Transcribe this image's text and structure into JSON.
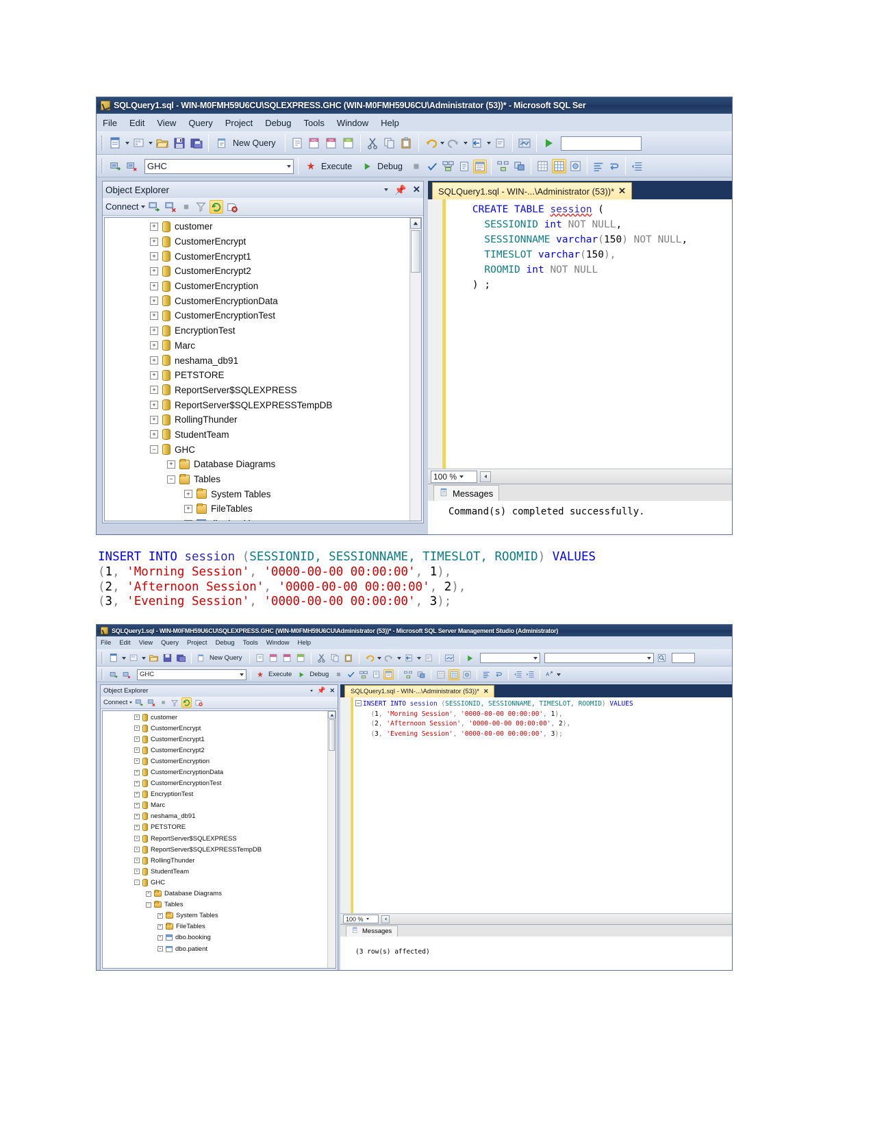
{
  "window_top": {
    "title": "SQLQuery1.sql - WIN-M0FMH59U6CU\\SQLEXPRESS.GHC (WIN-M0FMH59U6CU\\Administrator (53))* - Microsoft SQL Ser",
    "menu": [
      "File",
      "Edit",
      "View",
      "Query",
      "Project",
      "Debug",
      "Tools",
      "Window",
      "Help"
    ],
    "toolbar": {
      "new_query_label": "New Query",
      "database_combo": "GHC",
      "execute_label": "Execute",
      "debug_label": "Debug",
      "find_combo": ""
    },
    "object_explorer": {
      "title": "Object Explorer",
      "connect_label": "Connect",
      "nodes": [
        {
          "label": "customer",
          "icon": "database-icon",
          "state": "collapsed",
          "indent": 1
        },
        {
          "label": "CustomerEncrypt",
          "icon": "database-icon",
          "state": "collapsed",
          "indent": 1
        },
        {
          "label": "CustomerEncrypt1",
          "icon": "database-icon",
          "state": "collapsed",
          "indent": 1
        },
        {
          "label": "CustomerEncrypt2",
          "icon": "database-icon",
          "state": "collapsed",
          "indent": 1
        },
        {
          "label": "CustomerEncryption",
          "icon": "database-icon",
          "state": "collapsed",
          "indent": 1
        },
        {
          "label": "CustomerEncryptionData",
          "icon": "database-icon",
          "state": "collapsed",
          "indent": 1
        },
        {
          "label": "CustomerEncryptionTest",
          "icon": "database-icon",
          "state": "collapsed",
          "indent": 1
        },
        {
          "label": "EncryptionTest",
          "icon": "database-icon",
          "state": "collapsed",
          "indent": 1
        },
        {
          "label": "Marc",
          "icon": "database-icon",
          "state": "collapsed",
          "indent": 1
        },
        {
          "label": "neshama_db91",
          "icon": "database-icon",
          "state": "collapsed",
          "indent": 1
        },
        {
          "label": "PETSTORE",
          "icon": "database-icon",
          "state": "collapsed",
          "indent": 1
        },
        {
          "label": "ReportServer$SQLEXPRESS",
          "icon": "database-icon",
          "state": "collapsed",
          "indent": 1
        },
        {
          "label": "ReportServer$SQLEXPRESSTempDB",
          "icon": "database-icon",
          "state": "collapsed",
          "indent": 1
        },
        {
          "label": "RollingThunder",
          "icon": "database-icon",
          "state": "collapsed",
          "indent": 1
        },
        {
          "label": "StudentTeam",
          "icon": "database-icon",
          "state": "collapsed",
          "indent": 1
        },
        {
          "label": "GHC",
          "icon": "database-icon",
          "state": "expanded",
          "indent": 1
        },
        {
          "label": "Database Diagrams",
          "icon": "folder-icon",
          "state": "collapsed",
          "indent": 2
        },
        {
          "label": "Tables",
          "icon": "folder-icon",
          "state": "expanded",
          "indent": 2
        },
        {
          "label": "System Tables",
          "icon": "folder-icon",
          "state": "collapsed",
          "indent": 3
        },
        {
          "label": "FileTables",
          "icon": "folder-icon",
          "state": "collapsed",
          "indent": 3
        },
        {
          "label": "dbo.booking",
          "icon": "table-icon",
          "state": "collapsed",
          "indent": 3
        }
      ]
    },
    "document_tab": "SQLQuery1.sql - WIN-...\\Administrator (53))*",
    "code_lines": [
      [
        {
          "t": "    ",
          "c": "plain"
        },
        {
          "t": "CREATE",
          "c": "kw"
        },
        {
          "t": " ",
          "c": "plain"
        },
        {
          "t": "TABLE",
          "c": "kw"
        },
        {
          "t": " ",
          "c": "plain"
        },
        {
          "t": "session",
          "c": "ident-tbl sq"
        },
        {
          "t": " (",
          "c": "plain"
        }
      ],
      [
        {
          "t": "      ",
          "c": "plain"
        },
        {
          "t": "SESSIONID",
          "c": "idn"
        },
        {
          "t": " ",
          "c": "plain"
        },
        {
          "t": "int",
          "c": "typ"
        },
        {
          "t": " ",
          "c": "plain"
        },
        {
          "t": "NOT NULL",
          "c": "gry"
        },
        {
          "t": ",",
          "c": "plain"
        }
      ],
      [
        {
          "t": "      ",
          "c": "plain"
        },
        {
          "t": "SESSIONNAME",
          "c": "idn"
        },
        {
          "t": " ",
          "c": "plain"
        },
        {
          "t": "varchar",
          "c": "typ"
        },
        {
          "t": "(",
          "c": "gry"
        },
        {
          "t": "150",
          "c": "num"
        },
        {
          "t": ") ",
          "c": "gry"
        },
        {
          "t": "NOT NULL",
          "c": "gry"
        },
        {
          "t": ",",
          "c": "plain"
        }
      ],
      [
        {
          "t": "      ",
          "c": "plain"
        },
        {
          "t": "TIMESLOT",
          "c": "idn"
        },
        {
          "t": " ",
          "c": "plain"
        },
        {
          "t": "varchar",
          "c": "typ"
        },
        {
          "t": "(",
          "c": "gry"
        },
        {
          "t": "150",
          "c": "num"
        },
        {
          "t": "),",
          "c": "gry"
        }
      ],
      [
        {
          "t": "      ",
          "c": "plain"
        },
        {
          "t": "ROOMID",
          "c": "idn"
        },
        {
          "t": " ",
          "c": "plain"
        },
        {
          "t": "int",
          "c": "typ"
        },
        {
          "t": " ",
          "c": "plain"
        },
        {
          "t": "NOT NULL",
          "c": "gry"
        }
      ],
      [
        {
          "t": "    ) ;",
          "c": "plain"
        }
      ]
    ],
    "zoom_level": "100 %",
    "messages_tab": "Messages",
    "messages_text": "Command(s) completed successfully."
  },
  "middle_sql": {
    "lines": [
      [
        {
          "t": "INSERT INTO ",
          "c": "kw"
        },
        {
          "t": "session ",
          "c": "ident-tbl"
        },
        {
          "t": "(",
          "c": "gry"
        },
        {
          "t": "SESSIONID, SESSIONNAME, TIMESLOT, ROOMID",
          "c": "idn"
        },
        {
          "t": ") ",
          "c": "gry"
        },
        {
          "t": "VALUES",
          "c": "kw"
        }
      ],
      [
        {
          "t": "(",
          "c": "gry"
        },
        {
          "t": "1",
          "c": "num"
        },
        {
          "t": ", ",
          "c": "gry"
        },
        {
          "t": "'Morning Session'",
          "c": "str"
        },
        {
          "t": ", ",
          "c": "gry"
        },
        {
          "t": "'0000-00-00 00:00:00'",
          "c": "str"
        },
        {
          "t": ", ",
          "c": "gry"
        },
        {
          "t": "1",
          "c": "num"
        },
        {
          "t": "),",
          "c": "gry"
        }
      ],
      [
        {
          "t": "(",
          "c": "gry"
        },
        {
          "t": "2",
          "c": "num"
        },
        {
          "t": ", ",
          "c": "gry"
        },
        {
          "t": "'Afternoon Session'",
          "c": "str"
        },
        {
          "t": ", ",
          "c": "gry"
        },
        {
          "t": "'0000-00-00 00:00:00'",
          "c": "str"
        },
        {
          "t": ", ",
          "c": "gry"
        },
        {
          "t": "2",
          "c": "num"
        },
        {
          "t": "),",
          "c": "gry"
        }
      ],
      [
        {
          "t": "(",
          "c": "gry"
        },
        {
          "t": "3",
          "c": "num"
        },
        {
          "t": ", ",
          "c": "gry"
        },
        {
          "t": "'Evening Session'",
          "c": "str"
        },
        {
          "t": ", ",
          "c": "gry"
        },
        {
          "t": "'0000-00-00 00:00:00'",
          "c": "str"
        },
        {
          "t": ", ",
          "c": "gry"
        },
        {
          "t": "3",
          "c": "num"
        },
        {
          "t": ");",
          "c": "gry"
        }
      ]
    ]
  },
  "window_bottom": {
    "title": "SQLQuery1.sql - WIN-M0FMH59U6CU\\SQLEXPRESS.GHC (WIN-M0FMH59U6CU\\Administrator (53))* - Microsoft SQL Server Management Studio (Administrator)",
    "menu": [
      "File",
      "Edit",
      "View",
      "Query",
      "Project",
      "Debug",
      "Tools",
      "Window",
      "Help"
    ],
    "toolbar": {
      "new_query_label": "New Query",
      "database_combo": "GHC",
      "execute_label": "Execute",
      "debug_label": "Debug",
      "find_combo": ""
    },
    "object_explorer": {
      "title": "Object Explorer",
      "connect_label": "Connect",
      "nodes": [
        {
          "label": "customer",
          "icon": "database-icon",
          "state": "collapsed",
          "indent": 1
        },
        {
          "label": "CustomerEncrypt",
          "icon": "database-icon",
          "state": "collapsed",
          "indent": 1
        },
        {
          "label": "CustomerEncrypt1",
          "icon": "database-icon",
          "state": "collapsed",
          "indent": 1
        },
        {
          "label": "CustomerEncrypt2",
          "icon": "database-icon",
          "state": "collapsed",
          "indent": 1
        },
        {
          "label": "CustomerEncryption",
          "icon": "database-icon",
          "state": "collapsed",
          "indent": 1
        },
        {
          "label": "CustomerEncryptionData",
          "icon": "database-icon",
          "state": "collapsed",
          "indent": 1
        },
        {
          "label": "CustomerEncryptionTest",
          "icon": "database-icon",
          "state": "collapsed",
          "indent": 1
        },
        {
          "label": "EncryptionTest",
          "icon": "database-icon",
          "state": "collapsed",
          "indent": 1
        },
        {
          "label": "Marc",
          "icon": "database-icon",
          "state": "collapsed",
          "indent": 1
        },
        {
          "label": "neshama_db91",
          "icon": "database-icon",
          "state": "collapsed",
          "indent": 1
        },
        {
          "label": "PETSTORE",
          "icon": "database-icon",
          "state": "collapsed",
          "indent": 1
        },
        {
          "label": "ReportServer$SQLEXPRESS",
          "icon": "database-icon",
          "state": "collapsed",
          "indent": 1
        },
        {
          "label": "ReportServer$SQLEXPRESSTempDB",
          "icon": "database-icon",
          "state": "collapsed",
          "indent": 1
        },
        {
          "label": "RollingThunder",
          "icon": "database-icon",
          "state": "collapsed",
          "indent": 1
        },
        {
          "label": "StudentTeam",
          "icon": "database-icon",
          "state": "collapsed",
          "indent": 1
        },
        {
          "label": "GHC",
          "icon": "database-icon",
          "state": "expanded",
          "indent": 1
        },
        {
          "label": "Database Diagrams",
          "icon": "folder-icon",
          "state": "collapsed",
          "indent": 2
        },
        {
          "label": "Tables",
          "icon": "folder-icon",
          "state": "expanded",
          "indent": 2
        },
        {
          "label": "System Tables",
          "icon": "folder-icon",
          "state": "collapsed",
          "indent": 3
        },
        {
          "label": "FileTables",
          "icon": "folder-icon",
          "state": "collapsed",
          "indent": 3
        },
        {
          "label": "dbo.booking",
          "icon": "table-icon",
          "state": "collapsed",
          "indent": 3
        },
        {
          "label": "dbo.patient",
          "icon": "table-icon",
          "state": "collapsed",
          "indent": 3
        }
      ]
    },
    "document_tab": "SQLQuery1.sql - WIN-...\\Administrator (53))*",
    "code_lines": [
      [
        {
          "t": "INSERT INTO ",
          "c": "kw"
        },
        {
          "t": "session ",
          "c": "ident-tbl"
        },
        {
          "t": "(",
          "c": "gry"
        },
        {
          "t": "SESSIONID, SESSIONNAME, TIMESLOT, ROOMID",
          "c": "idn"
        },
        {
          "t": ") ",
          "c": "gry"
        },
        {
          "t": "VALUES",
          "c": "kw"
        }
      ],
      [
        {
          "t": "  (",
          "c": "gry"
        },
        {
          "t": "1",
          "c": "num"
        },
        {
          "t": ", ",
          "c": "gry"
        },
        {
          "t": "'Morning Session'",
          "c": "str"
        },
        {
          "t": ", ",
          "c": "gry"
        },
        {
          "t": "'0000-00-00 00:00:00'",
          "c": "str"
        },
        {
          "t": ", ",
          "c": "gry"
        },
        {
          "t": "1",
          "c": "num"
        },
        {
          "t": "),",
          "c": "gry"
        }
      ],
      [
        {
          "t": "  (",
          "c": "gry"
        },
        {
          "t": "2",
          "c": "num"
        },
        {
          "t": ", ",
          "c": "gry"
        },
        {
          "t": "'Afternoon Session'",
          "c": "str"
        },
        {
          "t": ", ",
          "c": "gry"
        },
        {
          "t": "'0000-00-00 00:00:00'",
          "c": "str"
        },
        {
          "t": ", ",
          "c": "gry"
        },
        {
          "t": "2",
          "c": "num"
        },
        {
          "t": "),",
          "c": "gry"
        }
      ],
      [
        {
          "t": "  (",
          "c": "gry"
        },
        {
          "t": "3",
          "c": "num"
        },
        {
          "t": ", ",
          "c": "gry"
        },
        {
          "t": "'Evening Session'",
          "c": "str"
        },
        {
          "t": ", ",
          "c": "gry"
        },
        {
          "t": "'0000-00-00 00:00:00'",
          "c": "str"
        },
        {
          "t": ", ",
          "c": "gry"
        },
        {
          "t": "3",
          "c": "num"
        },
        {
          "t": ");",
          "c": "gry"
        }
      ]
    ],
    "zoom_level": "100 %",
    "messages_tab": "Messages",
    "messages_text": "(3 row(s) affected)"
  },
  "colors": {
    "title_bar": "#24406a",
    "tab_active": "#ffe9a8",
    "accent_yellow": "#f5d93a",
    "keyword_blue": "#0000ff",
    "string_red": "#d00000",
    "identifier_teal": "#0a7b83"
  }
}
